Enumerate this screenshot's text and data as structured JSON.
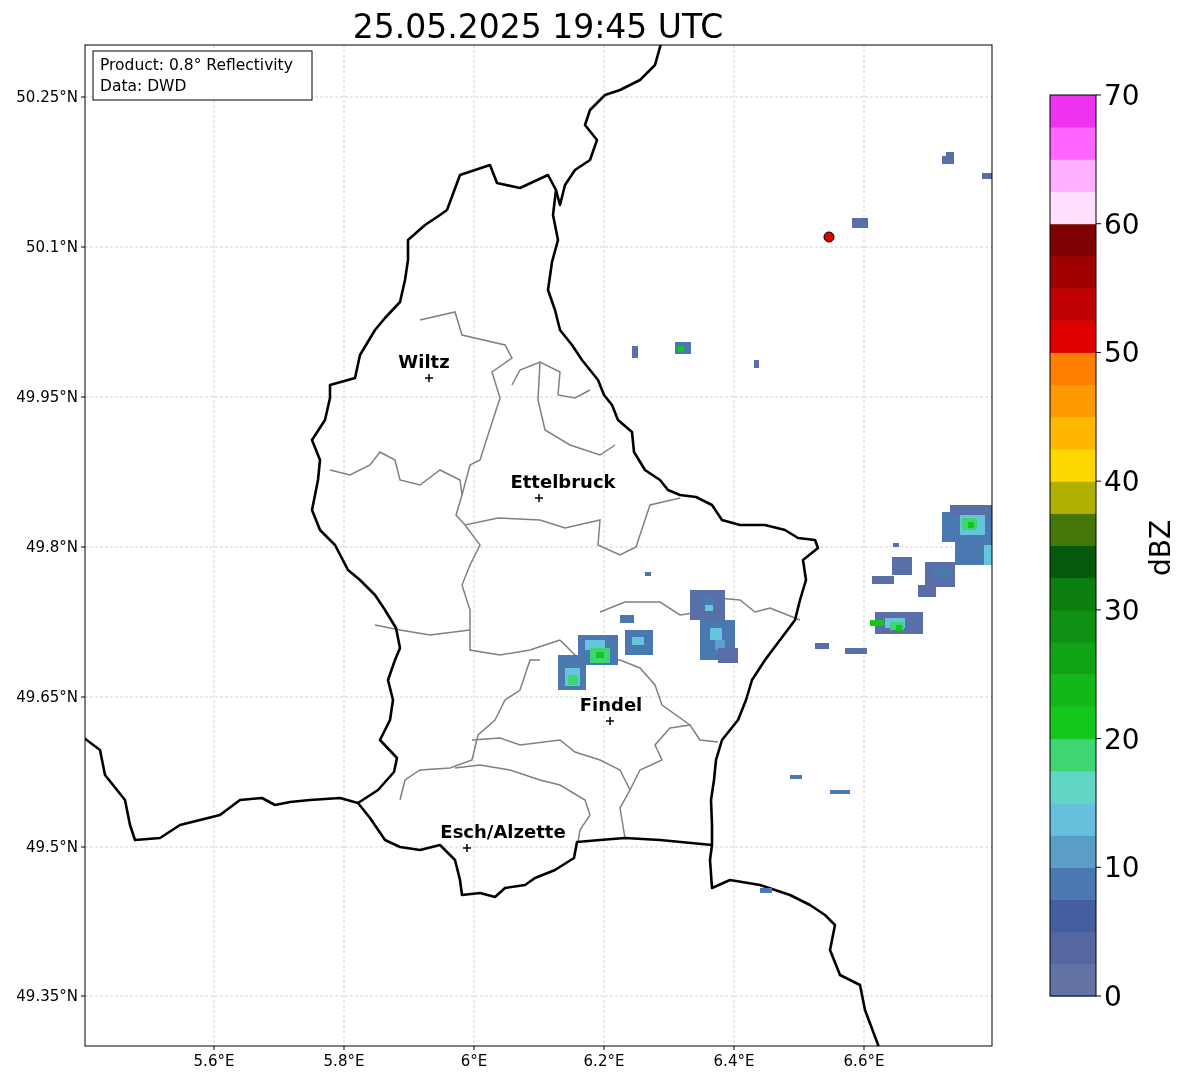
{
  "title": "25.05.2025 19:45 UTC",
  "info_box": [
    "Product: 0.8° Reflectivity",
    "Data: DWD"
  ],
  "x_ticks": [
    "5.6°E",
    "5.8°E",
    "6°E",
    "6.2°E",
    "6.4°E",
    "6.6°E"
  ],
  "y_ticks": [
    "50.25°N",
    "50.1°N",
    "49.95°N",
    "49.8°N",
    "49.65°N",
    "49.5°N",
    "49.35°N"
  ],
  "cities": [
    {
      "name": "Wiltz"
    },
    {
      "name": "Ettelbruck"
    },
    {
      "name": "Findel"
    },
    {
      "name": "Esch/Alzette"
    }
  ],
  "colorbar": {
    "label": "dBZ",
    "ticks": [
      "70",
      "60",
      "50",
      "40",
      "30",
      "20",
      "10",
      "0"
    ],
    "bins": [
      {
        "color": "#6473a6"
      },
      {
        "color": "#5566a0"
      },
      {
        "color": "#445ea2"
      },
      {
        "color": "#4a78b0"
      },
      {
        "color": "#5a9ec8"
      },
      {
        "color": "#66c0dd"
      },
      {
        "color": "#62d6c4"
      },
      {
        "color": "#3ed672"
      },
      {
        "color": "#12c81a"
      },
      {
        "color": "#11b818"
      },
      {
        "color": "#10a414"
      },
      {
        "color": "#0e9012"
      },
      {
        "color": "#0b7e0f"
      },
      {
        "color": "#075a0b"
      },
      {
        "color": "#457708"
      },
      {
        "color": "#b0b000"
      },
      {
        "color": "#ffd700"
      },
      {
        "color": "#ffb700"
      },
      {
        "color": "#ff9a00"
      },
      {
        "color": "#ff7f00"
      },
      {
        "color": "#e00000"
      },
      {
        "color": "#bf0000"
      },
      {
        "color": "#a00000"
      },
      {
        "color": "#7f0000"
      },
      {
        "color": "#ffe0ff"
      },
      {
        "color": "#ffb0ff"
      },
      {
        "color": "#ff66ff"
      },
      {
        "color": "#ee33ee"
      }
    ]
  }
}
